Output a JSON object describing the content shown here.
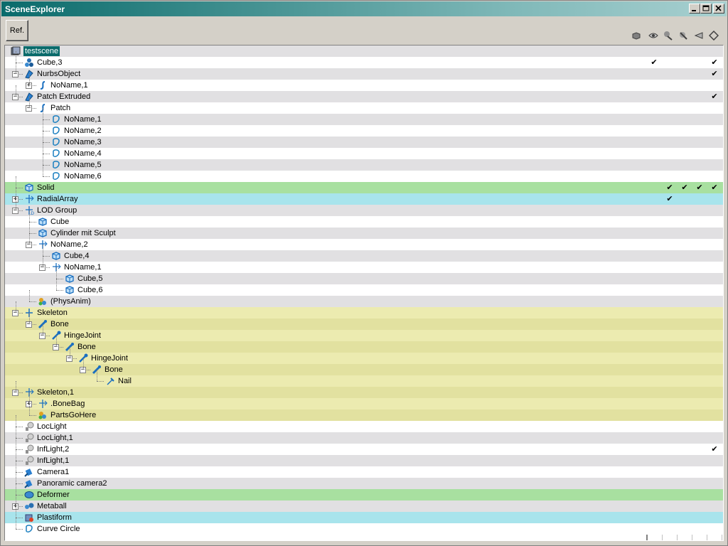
{
  "window": {
    "title": "SceneExplorer",
    "minimize_label": "_",
    "maximize_label": "□",
    "close_label": "×"
  },
  "toolbar": {
    "ref_label": "Ref."
  },
  "columns": [
    {
      "name": "selectable",
      "icon": "cube-icon"
    },
    {
      "name": "visibility",
      "icon": "eye-icon"
    },
    {
      "name": "render",
      "icon": "render-icon"
    },
    {
      "name": "shadow",
      "icon": "shadow-icon"
    },
    {
      "name": "lock",
      "icon": "lock-icon"
    },
    {
      "name": "wire",
      "icon": "wire-icon"
    }
  ],
  "check_mark": "✔",
  "rows": [
    {
      "label": "testscene",
      "depth": 0,
      "icon": "scene-icon",
      "bg": "odd",
      "expander": "",
      "selected": true,
      "checks": []
    },
    {
      "label": "Cube,3",
      "depth": 1,
      "icon": "polymesh-icon",
      "bg": "even",
      "expander": "",
      "checks": [
        0,
        4
      ]
    },
    {
      "label": "NurbsObject",
      "depth": 1,
      "icon": "nurbs-icon",
      "bg": "odd",
      "expander": "−",
      "checks": [
        4
      ]
    },
    {
      "label": "NoName,1",
      "depth": 2,
      "icon": "curve-icon",
      "bg": "even",
      "expander": "+",
      "checks": []
    },
    {
      "label": "Patch Extruded",
      "depth": 1,
      "icon": "nurbs-icon",
      "bg": "odd",
      "expander": "−",
      "checks": [
        4
      ]
    },
    {
      "label": "Patch",
      "depth": 2,
      "icon": "curve-icon",
      "bg": "even",
      "expander": "−",
      "checks": []
    },
    {
      "label": "NoName,1",
      "depth": 3,
      "icon": "spline-icon",
      "bg": "odd",
      "expander": "",
      "checks": []
    },
    {
      "label": "NoName,2",
      "depth": 3,
      "icon": "spline-icon",
      "bg": "even",
      "expander": "",
      "checks": []
    },
    {
      "label": "NoName,3",
      "depth": 3,
      "icon": "spline-icon",
      "bg": "odd",
      "expander": "",
      "checks": []
    },
    {
      "label": "NoName,4",
      "depth": 3,
      "icon": "spline-icon",
      "bg": "even",
      "expander": "",
      "checks": []
    },
    {
      "label": "NoName,5",
      "depth": 3,
      "icon": "spline-icon",
      "bg": "odd",
      "expander": "",
      "checks": []
    },
    {
      "label": "NoName,6",
      "depth": 3,
      "icon": "spline-icon",
      "bg": "even",
      "expander": "",
      "checks": []
    },
    {
      "label": "Solid",
      "depth": 1,
      "icon": "solid-icon",
      "bg": "green",
      "expander": "",
      "checks": [
        1,
        2,
        3,
        4
      ]
    },
    {
      "label": "RadialArray",
      "depth": 1,
      "icon": "null-icon",
      "bg": "cyan",
      "expander": "+",
      "checks": [
        1
      ]
    },
    {
      "label": "LOD Group",
      "depth": 1,
      "icon": "lod-icon",
      "bg": "odd",
      "expander": "−",
      "checks": []
    },
    {
      "label": "Cube",
      "depth": 2,
      "icon": "solid-icon",
      "bg": "even",
      "expander": "",
      "checks": []
    },
    {
      "label": "Cylinder mit Sculpt",
      "depth": 2,
      "icon": "solid-icon",
      "bg": "odd",
      "expander": "",
      "checks": []
    },
    {
      "label": "NoName,2",
      "depth": 2,
      "icon": "null-icon",
      "bg": "even",
      "expander": "−",
      "checks": []
    },
    {
      "label": "Cube,4",
      "depth": 3,
      "icon": "solid-icon",
      "bg": "odd",
      "expander": "",
      "checks": []
    },
    {
      "label": "NoName,1",
      "depth": 3,
      "icon": "null-icon",
      "bg": "even",
      "expander": "−",
      "checks": []
    },
    {
      "label": "Cube,5",
      "depth": 4,
      "icon": "solid-icon",
      "bg": "odd",
      "expander": "",
      "checks": []
    },
    {
      "label": "Cube,6",
      "depth": 4,
      "icon": "solid-icon",
      "bg": "even",
      "expander": "",
      "checks": []
    },
    {
      "label": "(PhysAnim)",
      "depth": 2,
      "icon": "physanim-icon",
      "bg": "odd",
      "expander": "",
      "checks": []
    },
    {
      "label": "Skeleton",
      "depth": 1,
      "icon": "skeleton-icon",
      "bg": "yellow-a",
      "expander": "−",
      "checks": []
    },
    {
      "label": "Bone",
      "depth": 2,
      "icon": "bone-icon",
      "bg": "yellow-b",
      "expander": "−",
      "checks": []
    },
    {
      "label": "HingeJoint",
      "depth": 3,
      "icon": "joint-icon",
      "bg": "yellow-a",
      "expander": "−",
      "checks": []
    },
    {
      "label": "Bone",
      "depth": 4,
      "icon": "bone-icon",
      "bg": "yellow-b",
      "expander": "−",
      "checks": []
    },
    {
      "label": "HingeJoint",
      "depth": 5,
      "icon": "joint-icon",
      "bg": "yellow-a",
      "expander": "−",
      "checks": []
    },
    {
      "label": "Bone",
      "depth": 6,
      "icon": "bone-icon",
      "bg": "yellow-b",
      "expander": "−",
      "checks": []
    },
    {
      "label": "Nail",
      "depth": 7,
      "icon": "nail-icon",
      "bg": "yellow-a",
      "expander": "",
      "checks": []
    },
    {
      "label": "Skeleton,1",
      "depth": 1,
      "icon": "null-icon",
      "bg": "yellow-b",
      "expander": "−",
      "checks": []
    },
    {
      "label": ".BoneBag",
      "depth": 2,
      "icon": "null-icon",
      "bg": "yellow-a",
      "expander": "+",
      "checks": []
    },
    {
      "label": "PartsGoHere",
      "depth": 2,
      "icon": "physanim-icon",
      "bg": "yellow-b",
      "expander": "",
      "checks": []
    },
    {
      "label": "LocLight",
      "depth": 1,
      "icon": "light-icon",
      "bg": "even",
      "expander": "",
      "checks": []
    },
    {
      "label": "LocLight,1",
      "depth": 1,
      "icon": "light-icon",
      "bg": "odd",
      "expander": "",
      "checks": []
    },
    {
      "label": "InfLight,2",
      "depth": 1,
      "icon": "light-icon",
      "bg": "even",
      "expander": "",
      "checks": [
        4
      ]
    },
    {
      "label": "InfLight,1",
      "depth": 1,
      "icon": "light-icon",
      "bg": "odd",
      "expander": "",
      "checks": []
    },
    {
      "label": "Camera1",
      "depth": 1,
      "icon": "camera-icon",
      "bg": "even",
      "expander": "",
      "checks": []
    },
    {
      "label": "Panoramic camera2",
      "depth": 1,
      "icon": "camera-icon",
      "bg": "odd",
      "expander": "",
      "checks": []
    },
    {
      "label": "Deformer",
      "depth": 1,
      "icon": "deformer-icon",
      "bg": "green",
      "expander": "",
      "checks": []
    },
    {
      "label": "Metaball",
      "depth": 1,
      "icon": "metaball-icon",
      "bg": "odd",
      "expander": "+",
      "checks": []
    },
    {
      "label": "Plastiform",
      "depth": 1,
      "icon": "plastiform-icon",
      "bg": "cyan",
      "expander": "",
      "checks": []
    },
    {
      "label": "Curve Circle",
      "depth": 1,
      "icon": "spline-icon",
      "bg": "even",
      "expander": "",
      "checks": []
    }
  ]
}
